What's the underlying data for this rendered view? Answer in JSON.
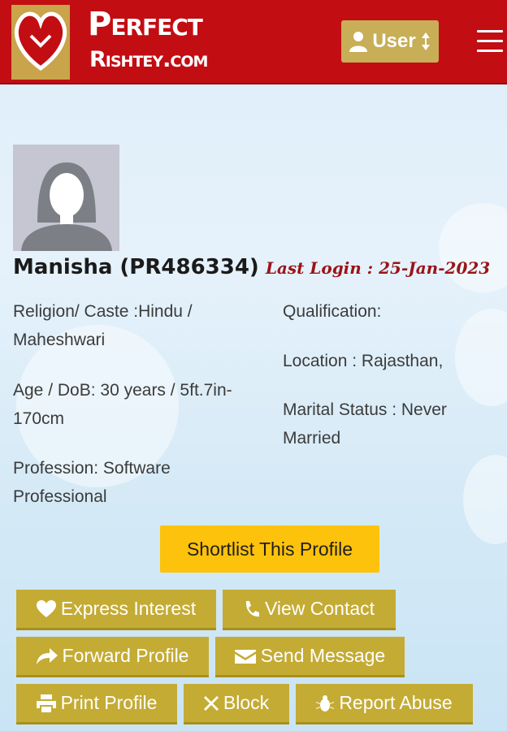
{
  "header": {
    "brand_line1": "Perfect",
    "brand_line2": "Rishtey.com",
    "user_button_label": "User",
    "menu_icon": "hamburger-menu-icon",
    "colors": {
      "header_bg": "#c20d13",
      "button_gold": "#c7ae57"
    }
  },
  "profile": {
    "name": "Manisha (PR486334)",
    "last_login": "Last Login : 25-Jan-2023",
    "religion_caste": "Religion/ Caste :Hindu / Maheshwari",
    "age_dob": "Age / DoB: 30 years / 5ft.7in-170cm",
    "profession": "Profession: Software Professional",
    "qualification": "Qualification:",
    "location": "Location : Rajasthan,",
    "marital_status": "Marital Status : Never Married"
  },
  "actions": {
    "shortlist": "Shortlist This Profile",
    "express_interest": "Express Interest",
    "view_contact": "View Contact",
    "forward_profile": "Forward Profile",
    "send_message": "Send Message",
    "print_profile": "Print Profile",
    "block": "Block",
    "report_abuse": "Report Abuse",
    "colors": {
      "action_gold": "#c4ab34",
      "shortlist_yellow": "#fdc20b"
    }
  }
}
